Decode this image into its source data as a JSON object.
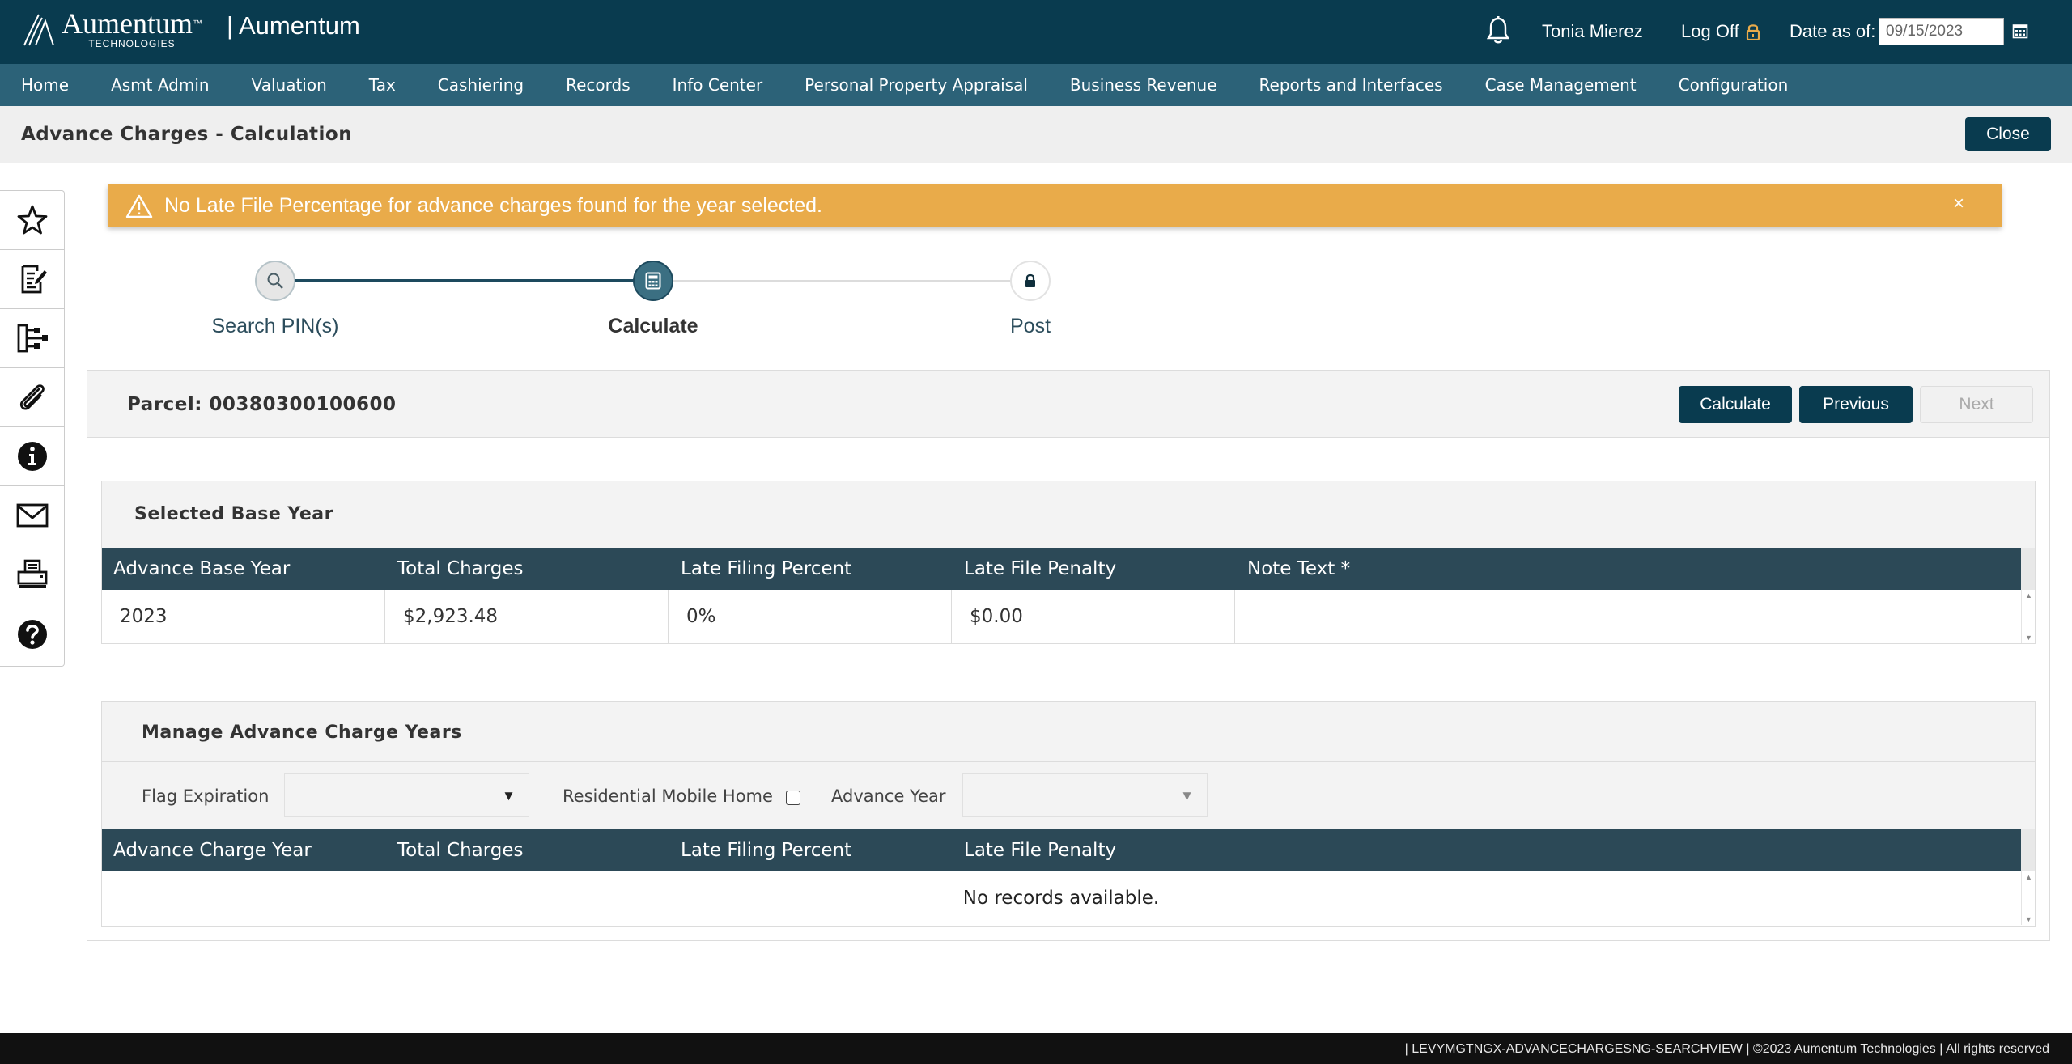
{
  "header": {
    "logo_main": "Aumentum",
    "logo_tm": "™",
    "logo_sub": "TECHNOLOGIES",
    "app_name": "| Aumentum",
    "user_name": "Tonia Mierez",
    "logoff_label": "Log Off",
    "date_label": "Date as of:",
    "date_value": "09/15/2023",
    "colors": {
      "bar": "#093b4f",
      "lock": "#e9ab4a"
    }
  },
  "nav": {
    "items": [
      "Home",
      "Asmt Admin",
      "Valuation",
      "Tax",
      "Cashiering",
      "Records",
      "Info Center",
      "Personal Property Appraisal",
      "Business Revenue",
      "Reports and Interfaces",
      "Case Management",
      "Configuration"
    ],
    "color": "#2c6278"
  },
  "page": {
    "title": "Advance Charges - Calculation",
    "close_label": "Close"
  },
  "sidebar": {
    "icons": [
      "star-icon",
      "edit-document-icon",
      "hierarchy-icon",
      "paperclip-icon",
      "info-icon",
      "mail-icon",
      "print-icon",
      "help-icon"
    ]
  },
  "alert": {
    "message": "No Late File Percentage for advance charges found for the year selected.",
    "dismiss": "×",
    "color": "#e9ab4a"
  },
  "stepper": {
    "steps": [
      {
        "label": "Search PIN(s)",
        "icon": "search-icon",
        "state": "completed"
      },
      {
        "label": "Calculate",
        "icon": "calculator-icon",
        "state": "active"
      },
      {
        "label": "Post",
        "icon": "lock-icon",
        "state": "locked"
      }
    ]
  },
  "panel": {
    "parcel_label": "Parcel: 00380300100600",
    "buttons": {
      "calculate": "Calculate",
      "previous": "Previous",
      "next": "Next"
    },
    "next_disabled": true
  },
  "base_year": {
    "title": "Selected Base Year",
    "columns": [
      "Advance Base Year",
      "Total Charges",
      "Late Filing Percent",
      "Late File Penalty",
      "Note Text *"
    ],
    "rows": [
      [
        "2023",
        "$2,923.48",
        "0%",
        "$0.00",
        ""
      ]
    ]
  },
  "manage": {
    "title": "Manage Advance Charge Years",
    "filters": {
      "flag_expiration_label": "Flag Expiration",
      "flag_expiration_value": "",
      "residential_mobile_home_label": "Residential Mobile Home",
      "residential_mobile_home_checked": false,
      "advance_year_label": "Advance Year",
      "advance_year_value": ""
    },
    "columns": [
      "Advance Charge Year",
      "Total Charges",
      "Late Filing Percent",
      "Late File Penalty"
    ],
    "empty_message": "No records available."
  },
  "footer": {
    "text": "|   LEVYMGTNGX-ADVANCECHARGESNG-SEARCHVIEW     |   ©2023 Aumentum Technologies | All rights reserved"
  }
}
